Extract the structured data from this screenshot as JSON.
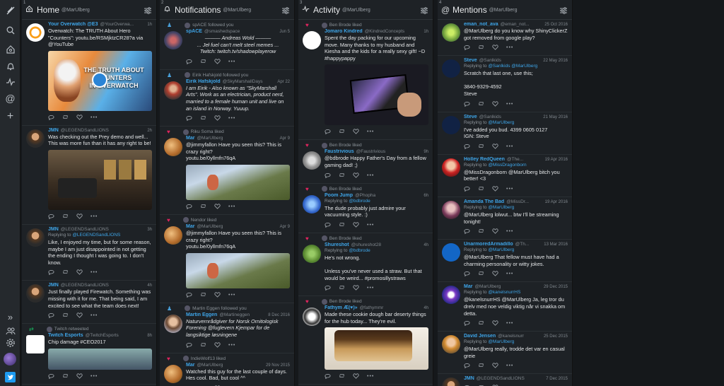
{
  "sidebar": {
    "twitter_logo": "twitter-bird"
  },
  "columns": [
    {
      "num": "1",
      "icon": "home-icon",
      "title": "Home",
      "account": "@MarUlberg",
      "tweets": [
        {
          "ctx": null,
          "name": "Your Overwatch @E3",
          "handle": "@YourOverwa...",
          "time": "1h",
          "reply": null,
          "text": "Overwatch: The TRUTH About Hero \"Counters\": youtu.be/RSMjktzCR28?a via @YouTube",
          "media": "overwatch",
          "media_caption": "THE TRUTH ABOUT\nCOUNTERS\nIN OVERWATCH",
          "avatar": "ow"
        },
        {
          "ctx": null,
          "name": "JMN",
          "handle": "@LEGENDSandLIONS",
          "time": "2h",
          "reply": null,
          "text": "Was checking out the Prey demo and well... This was more fun than it has any right to be!",
          "media": "prey",
          "avatar": "jmn"
        },
        {
          "ctx": null,
          "name": "JMN",
          "handle": "@LEGENDSandLIONS",
          "time": "3h",
          "reply": "@LEGENDSandLIONS",
          "text": "Like, I enjoyed my time, but for some reason, maybe I am just disappointed in not getting the ending I thought I was going to. I don't know.",
          "media": null,
          "avatar": "jmn"
        },
        {
          "ctx": null,
          "name": "JMN",
          "handle": "@LEGENDSandLIONS",
          "time": "4h",
          "reply": null,
          "text": "Just finally played Firewatch. Something was missing with it for me. That being said, I am excited to see what the team does next!",
          "media": null,
          "avatar": "jmn"
        },
        {
          "ctx": {
            "type": "rt",
            "text": "Twitch retweeted"
          },
          "name": "Twitch Esports",
          "handle": "@TwitchEsports",
          "time": "8h",
          "reply": null,
          "text": "Chip damage #CEO2017",
          "media": "chip",
          "avatar": "twitch"
        }
      ]
    },
    {
      "num": "2",
      "icon": "bell-icon",
      "title": "Notifications",
      "account": "@MarUlberg",
      "tweets": [
        {
          "ctx": {
            "type": "fol",
            "text": "spACE followed you"
          },
          "name": "spACE",
          "handle": "@smashedspace",
          "time": "Jun 5",
          "reply": null,
          "text": "——— Andreas Wold ———\n... Jeł fuel can't melt steel memes ...\nTwitch: twitch.tv/shadowplayerow",
          "media": null,
          "avatar": "space",
          "center": true,
          "it": true
        },
        {
          "ctx": {
            "type": "fol",
            "text": "Eirik Hafskjold followed you"
          },
          "name": "Eirik Hafskjold",
          "handle": "@SkyMarshallDays",
          "time": "Apr 22",
          "reply": null,
          "text": "I am Eirik - Also known as \"SkyMarshall Arts\". Work as an electrician, product nerd, married to a female human unit and live on an island in Norway. Yuuup.",
          "media": null,
          "avatar": "eirik",
          "it": true
        },
        {
          "ctx": {
            "type": "heart",
            "text": "Riku Soma liked"
          },
          "name": "Mar",
          "handle": "@MarUlberg",
          "time": "Apr 9",
          "reply": null,
          "text": "@jimmyfallon Have you seen this? This is crazy right?\nyoutu.be/0yllmfn76qA",
          "media": "bike",
          "avatar": "mar",
          "time2": "Apr 9"
        },
        {
          "ctx": {
            "type": "heart",
            "text": "Nendor liked"
          },
          "name": "Mar",
          "handle": "@MarUlberg",
          "time": "Apr 9",
          "reply": null,
          "text": "@jimmyfallon Have you seen this? This is crazy right?\nyoutu.be/0yllmfn76qA",
          "media": "bike",
          "avatar": "mar"
        },
        {
          "ctx": {
            "type": "fol",
            "text": "Martin Eggen followed you"
          },
          "name": "Martin Eggen",
          "handle": "@Martineggen",
          "time": "8 Dec 2016",
          "reply": null,
          "text": "Naturvernrådgiver for Norsk Ornitologisk Forening @fuglevern Kjempar for de langsiktige løsningene",
          "media": null,
          "avatar": "martin",
          "it": true
        },
        {
          "ctx": {
            "type": "heart",
            "text": "IndieWolf13 liked"
          },
          "name": "Mar",
          "handle": "@MarUlberg",
          "time": "29 Nov 2015",
          "reply": null,
          "text": "Watched this guy for the last couple of days. Hes cool. Bad, but cool ^^",
          "media": null,
          "avatar": "mar"
        }
      ]
    },
    {
      "num": "3",
      "icon": "activity-icon",
      "title": "Activity",
      "account": "@MarUlberg",
      "tweets": [
        {
          "ctx": {
            "type": "heart",
            "text": "Ben Brode liked"
          },
          "name": "Jomaro Kindred",
          "handle": "@KindredConcepts",
          "time": "1h",
          "reply": null,
          "text": "Spent the day packing for our upcoming move. Many thanks to my husband and Kiesha and the kids for a really sexy gift! ~D #happypappy",
          "media": "tablet",
          "avatar": "jomaro"
        },
        {
          "ctx": {
            "type": "heart",
            "text": "Ben Brode liked"
          },
          "name": "Faustrivious",
          "handle": "@Faustrivious",
          "time": "9h",
          "reply": null,
          "text": "@bdbrode Happy Father's Day         from a fellow gaming dad! ;)",
          "media": null,
          "avatar": "faust"
        },
        {
          "ctx": {
            "type": "heart",
            "text": "Ben Brode liked"
          },
          "name": "Poom Jump",
          "handle": "@Phopha",
          "time": "6h",
          "reply": "@bdbrode",
          "text": "The dude probably just admire your vacuuming style. :)",
          "media": null,
          "avatar": "poom"
        },
        {
          "ctx": {
            "type": "heart",
            "text": "Ben Brode liked"
          },
          "name": "Shureshot",
          "handle": "@shureshot28",
          "time": "4h",
          "reply": "@bdbrode",
          "text": "He's not wrong.\n\nUnless you've never used a straw. But that would be weird... #promosillystraws",
          "media": null,
          "avatar": "shure"
        },
        {
          "ctx": {
            "type": "heart",
            "text": "Ben Brode liked"
          },
          "name": "Fathym Æ(♥)»",
          "handle": "@fathymmr",
          "time": "4h",
          "reply": null,
          "text": "Made these cookie dough bar deserty things for the hub today... They're evil.",
          "media": "cookie",
          "avatar": "fathym"
        }
      ]
    },
    {
      "num": "4",
      "icon": "at-icon",
      "title": "Mentions",
      "account": "@MarUlberg",
      "tweets": [
        {
          "ctx": null,
          "name": "eman_not_ava",
          "handle": "@eman_not...",
          "time": "25 Oct 2016",
          "reply": null,
          "text": "@MarUlberg do you know why ShinyClickerZ got removed from google play?",
          "media": null,
          "avatar": "eman"
        },
        {
          "ctx": null,
          "name": "Steve",
          "handle": "@Sanlkids",
          "time": "22 May 2016",
          "reply": "@Sanlkids @MarUlberg",
          "text": "Scratch that last one, use this;\n\n3840-9329-4592\nSteve",
          "media": null,
          "avatar": "steve"
        },
        {
          "ctx": null,
          "name": "Steve",
          "handle": "@Sanlkids",
          "time": "21 May 2016",
          "reply": "@MarUlberg",
          "text": "I've added you bud. 4399 0605 0127\nIGN: Steve",
          "media": null,
          "avatar": "steve"
        },
        {
          "ctx": null,
          "name": "Holley RedQueen",
          "handle": "@The...",
          "time": "19 Apr 2016",
          "reply": "@MissDragonborn",
          "text": "@MissDragonborn @MarUlberg bitch you better! <3",
          "media": null,
          "avatar": "holley"
        },
        {
          "ctx": null,
          "name": "Amanda The Bad",
          "handle": "@MissDr...",
          "time": "19 Apr 2016",
          "reply": "@MarUlberg",
          "text": "@MarUlberg lolwut... btw I'll be streaming tonight!",
          "media": null,
          "avatar": "amanda"
        },
        {
          "ctx": null,
          "name": "UnarmoredArmadillo",
          "handle": "@Th...",
          "time": "13 Mar 2016",
          "reply": "@MarUlberg",
          "text": "@MarUlberg That fellow must have had a charming personality or witty jokes.",
          "media": null,
          "avatar": "uaa"
        },
        {
          "ctx": null,
          "name": "Mar",
          "handle": "@MarUlberg",
          "time": "29 Dec 2015",
          "reply": "@kanelsnurrHS",
          "text": "@kanelsnurrHS @MarUlberg Ja, leg tror du drelv med noe veldig viktig når vi snakka om detta.",
          "media": null,
          "avatar": "mar2"
        },
        {
          "ctx": null,
          "name": "David Jensen",
          "handle": "@kanelsnurr",
          "time": "25 Dec 2015",
          "reply": "@MarUlberg",
          "text": "@MarUlberg really, trodde det var en casual greie",
          "media": null,
          "avatar": "david"
        },
        {
          "ctx": null,
          "name": "JMN",
          "handle": "@LEGENDSandLIONS",
          "time": "7 Dec 2015",
          "reply": null,
          "text": "",
          "media": null,
          "avatar": "jmn"
        }
      ]
    }
  ]
}
